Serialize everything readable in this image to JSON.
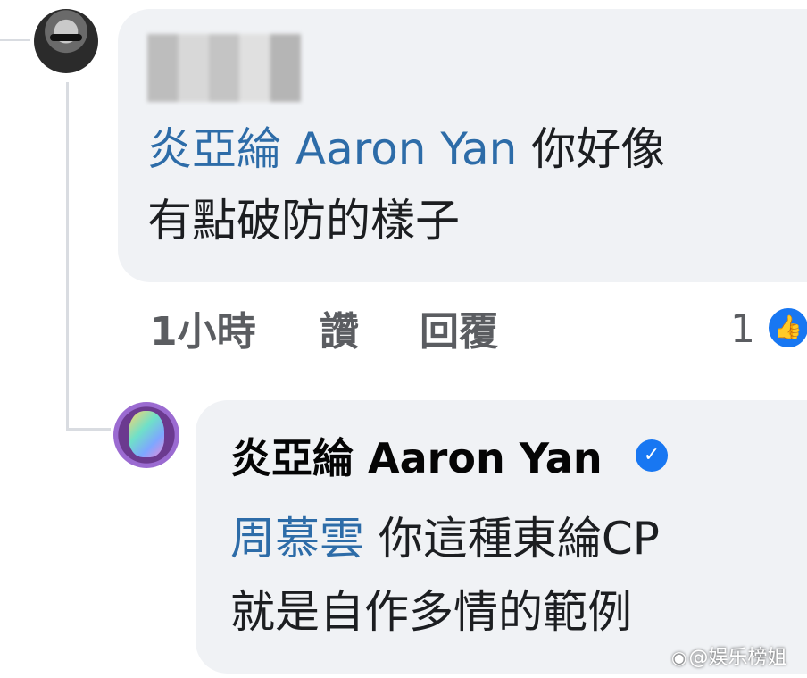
{
  "comment": {
    "mention": "炎亞綸 Aaron Yan",
    "text_line1_rest": " 你好像",
    "text_line2": "有點破防的樣子",
    "time": "1小時",
    "like_label": "讚",
    "reply_label": "回覆",
    "like_count": "1",
    "like_icon": "thumbs-up-icon"
  },
  "reply": {
    "author": "炎亞綸 Aaron Yan",
    "verified_icon": "verified-check-icon",
    "mention": "周慕雲",
    "text_line1_rest": " 你這種東綸CP",
    "text_line2": "就是自作多情的範例"
  },
  "watermark": {
    "text": "@娱乐榜姐"
  },
  "colors": {
    "mention": "#2d6ca8",
    "bubble": "#f0f2f5",
    "meta": "#5b5d61",
    "like_badge": "#1877f2"
  }
}
